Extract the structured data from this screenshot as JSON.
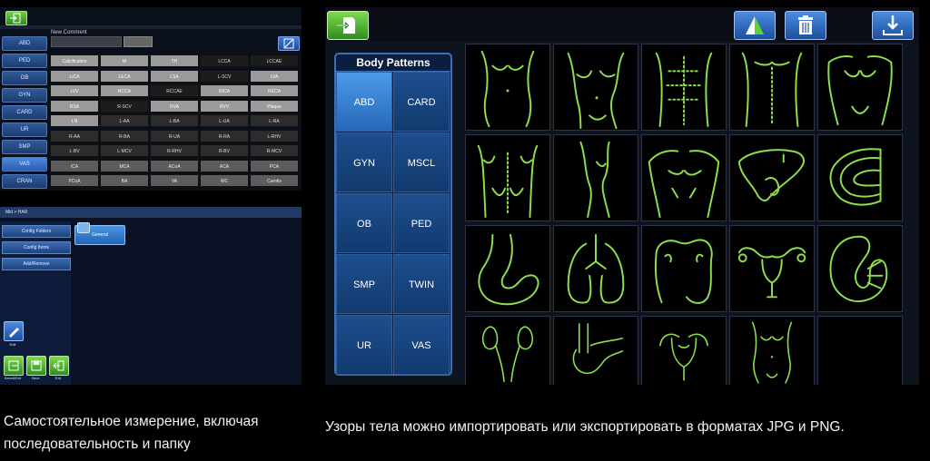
{
  "left_top": {
    "side_nav": [
      "ABD",
      "PED",
      "OB",
      "GYN",
      "CARD",
      "UR",
      "SMP",
      "VAS",
      "CRAN"
    ],
    "active_side_item": "VAS",
    "new_comment_label": "New Comment",
    "comment_grid": [
      [
        "Calcification",
        "M",
        "TH",
        "LCCA",
        "LCCAE"
      ],
      [
        "LICA",
        "LECA",
        "LSA",
        "L-SCV",
        "LVA"
      ],
      [
        "LVV",
        "RCCA",
        "RCCAE",
        "RICA",
        "RECA"
      ],
      [
        "RSA",
        "R-SCV",
        "RVA",
        "RVV",
        "Plaque"
      ],
      [
        "LN",
        "L-AA",
        "L-BA",
        "L-UA",
        "L-RA"
      ],
      [
        "R-AA",
        "R-BA",
        "R-UA",
        "R-RA",
        "L-RHV"
      ],
      [
        "L-BV",
        "L-MCV",
        "R-RHV",
        "R-BV",
        "R-MCV"
      ],
      [
        "ICA",
        "MCA",
        "ACoA",
        "ACA",
        "PCA"
      ],
      [
        "PCoA",
        "BA",
        "VA",
        "WC",
        "Carotis"
      ]
    ]
  },
  "left_bottom": {
    "breadcrumb": "Mid > HAR",
    "nav_items": [
      "Config Folders",
      "Config Items",
      "Add/Remove"
    ],
    "general_label": "General",
    "tools": {
      "edit": "Edit",
      "save_exit": "Save&Exit",
      "save": "Save",
      "exit": "Exit"
    }
  },
  "right": {
    "panel_title": "Body Patterns",
    "categories": [
      "ABD",
      "CARD",
      "GYN",
      "MSCL",
      "OB",
      "PED",
      "SMP",
      "TWIN",
      "UR",
      "VAS"
    ],
    "active_category": "ABD",
    "pattern_icons": [
      "female-torso-front-icon",
      "female-torso-side-icon",
      "male-torso-front-icon",
      "male-torso-front-2-icon",
      "male-torso-muscle-icon",
      "torso-back-icon",
      "torso-side-icon",
      "torso-arms-icon",
      "liver-icon",
      "ribcage-icon",
      "stomach-icon",
      "lungs-icon",
      "colon-icon",
      "uterus-icon",
      "kidney-icon",
      "kidneys-ureter-icon",
      "pancreas-icon",
      "uterus-2-icon",
      "female-torso-front-2-icon",
      ""
    ]
  },
  "captions": {
    "left": "Самостоятельное измерение, включая последовательность и папку",
    "right": "Узоры тела можно импортировать или экспортировать в форматах JPG и PNG."
  },
  "colors": {
    "pattern_line": "#8ee04a",
    "accent_blue": "#3b6fb6",
    "accent_green": "#4fb03a"
  }
}
